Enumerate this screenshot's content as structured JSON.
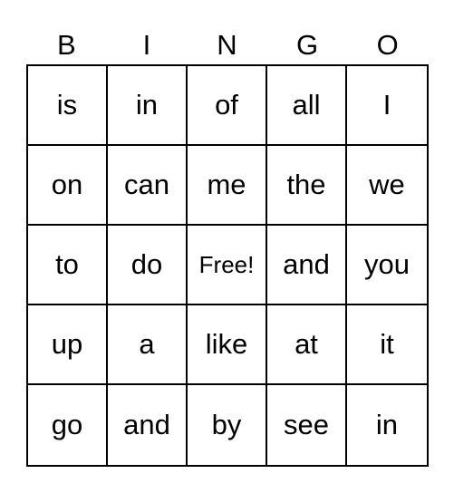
{
  "header": [
    "B",
    "I",
    "N",
    "G",
    "O"
  ],
  "cells": [
    "is",
    "in",
    "of",
    "all",
    "I",
    "on",
    "can",
    "me",
    "the",
    "we",
    "to",
    "do",
    "Free!",
    "and",
    "you",
    "up",
    "a",
    "like",
    "at",
    "it",
    "go",
    "and",
    "by",
    "see",
    "in"
  ]
}
